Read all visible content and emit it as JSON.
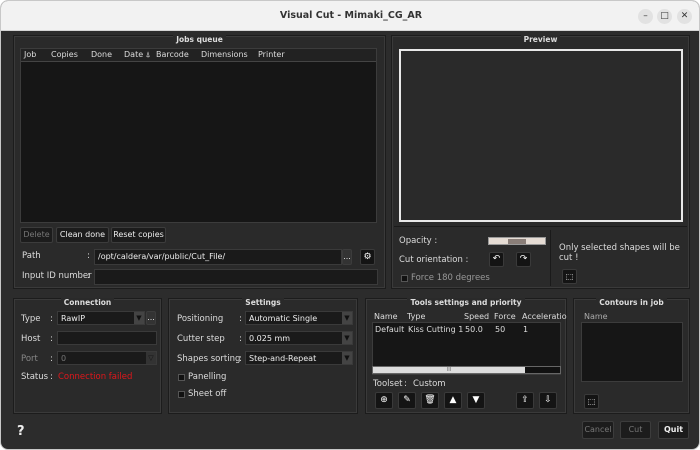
{
  "window": {
    "title": "Visual Cut - Mimaki_CG_AR",
    "minimize": "–",
    "maximize": "□",
    "close": "✕"
  },
  "jobs": {
    "title": "Jobs queue",
    "columns": [
      "Job",
      "Copies",
      "Done",
      "Date ⍋",
      "Barcode",
      "Dimensions",
      "Printer"
    ],
    "rows": [],
    "delete": "Delete",
    "clean_done": "Clean done",
    "reset_copies": "Reset copies",
    "path_label": "Path",
    "path_value": "/opt/caldera/var/public/Cut_File/",
    "browse": "...",
    "settings_icon": "gear-icon",
    "input_id_label": "Input ID number",
    "input_id_value": "",
    "colon": ":"
  },
  "preview": {
    "title": "Preview",
    "opacity_label": "Opacity :",
    "opacity_value": 0.5,
    "cut_orientation_label": "Cut orientation :",
    "rotate_left": "↶",
    "rotate_right": "↷",
    "force180_label": "Force 180 degrees",
    "force180_checked": false,
    "note": "Only selected shapes will be cut !"
  },
  "connection": {
    "title": "Connection",
    "type_label": "Type",
    "type_value": "RawIP",
    "browse": "...",
    "host_label": "Host",
    "host_value": "",
    "port_label": "Port",
    "port_value": "0",
    "status_label": "Status",
    "status_value": "Connection failed",
    "status_color": "#e0171b"
  },
  "settings": {
    "title": "Settings",
    "positioning_label": "Positioning",
    "positioning_value": "Automatic Single",
    "cutter_step_label": "Cutter step",
    "cutter_step_value": "0.025 mm",
    "shapes_sorting_label": "Shapes sorting",
    "shapes_sorting_value": "Step-and-Repeat",
    "panelling_label": "Panelling",
    "panelling_checked": false,
    "sheet_off_label": "Sheet off",
    "sheet_off_checked": false
  },
  "tools": {
    "title": "Tools settings and priority",
    "columns": [
      "Name",
      "Type",
      "Speed",
      "Force",
      "Acceleratio"
    ],
    "rows": [
      [
        "Default",
        "Kiss Cutting 1",
        "50.0",
        "50",
        "1"
      ]
    ],
    "toolset_label": "Toolset",
    "toolset_value": "Custom"
  },
  "contours": {
    "title": "Contours in job",
    "column": "Name"
  },
  "footer": {
    "help": "?",
    "cancel": "Cancel",
    "cut": "Cut",
    "quit": "Quit"
  }
}
